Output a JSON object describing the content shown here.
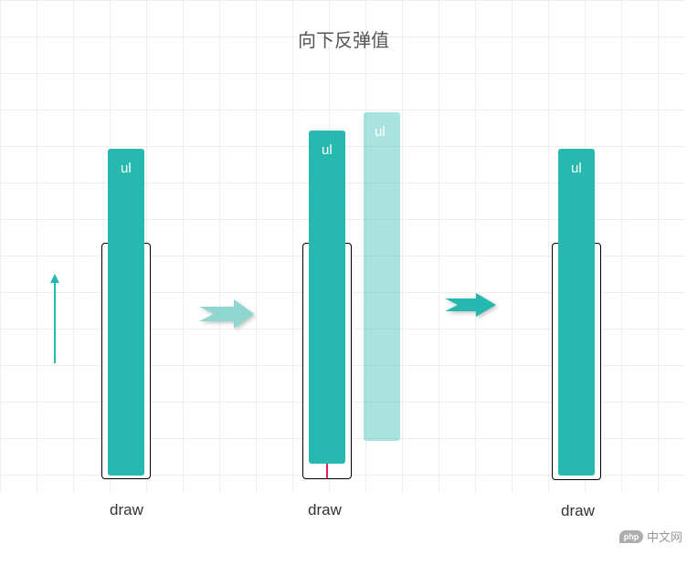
{
  "title": "向下反弹值",
  "stages": {
    "stage1": {
      "ul_label": "ul",
      "caption": "draw"
    },
    "stage2": {
      "ul_label": "ul",
      "ul_ghost_label": "ul",
      "caption": "draw"
    },
    "stage3": {
      "ul_label": "ul",
      "caption": "draw"
    }
  },
  "watermark": {
    "logo_text": "php",
    "label": "中文网"
  },
  "colors": {
    "primary": "#27b8af",
    "border": "#000000",
    "accent": "#e91e63",
    "grid": "#eeeeee"
  }
}
